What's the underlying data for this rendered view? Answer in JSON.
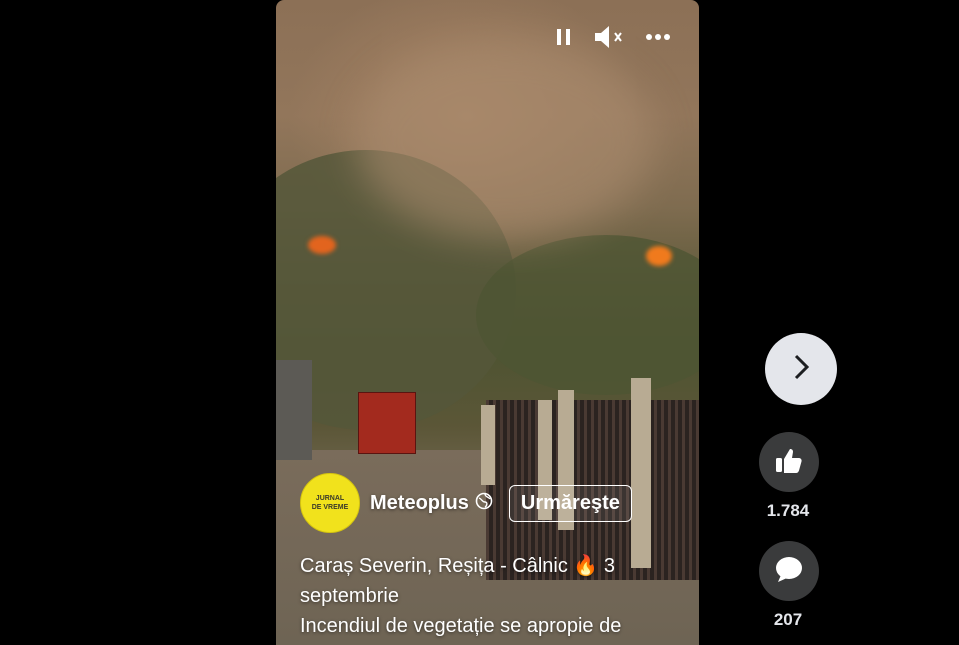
{
  "video": {
    "controls": {
      "pause_icon": "pause-icon",
      "mute_icon": "volume-muted-icon",
      "more_icon": "more-options-icon"
    }
  },
  "author": {
    "avatar_text_line1": "JURNAL",
    "avatar_text_line2": "DE VREME",
    "name": "Meteoplus",
    "visibility_icon": "globe-icon",
    "follow_label": "Urmăreşte"
  },
  "caption": {
    "line1": "Caraș Severin, Reșița - Câlnic 🔥 3",
    "line2": "septembrie",
    "line3": "Incendiul de vegetație se apropie de"
  },
  "sidebar": {
    "next_icon": "chevron-right-icon",
    "like_icon": "thumbs-up-icon",
    "like_count": "1.784",
    "comment_icon": "comment-icon",
    "comment_count": "207"
  },
  "colors": {
    "background": "#000000",
    "next_button_bg": "#e4e6eb",
    "side_button_bg": "#3a3b3c",
    "avatar_bg": "#f1e21c"
  }
}
